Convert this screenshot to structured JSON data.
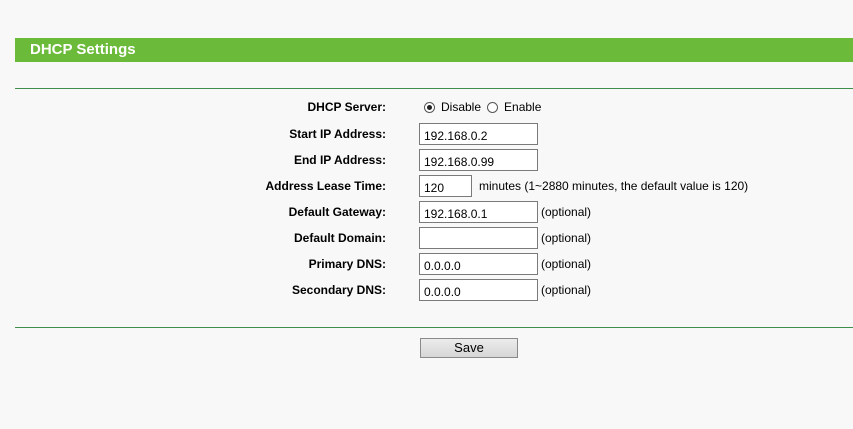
{
  "header": {
    "title": "DHCP Settings"
  },
  "form": {
    "dhcp_server": {
      "label": "DHCP Server:",
      "options": [
        {
          "label": "Disable",
          "checked": true
        },
        {
          "label": "Enable",
          "checked": false
        }
      ]
    },
    "start_ip": {
      "label": "Start IP Address:",
      "value": "192.168.0.2"
    },
    "end_ip": {
      "label": "End IP Address:",
      "value": "192.168.0.99"
    },
    "lease_time": {
      "label": "Address Lease Time:",
      "value": "120",
      "hint": "minutes (1~2880 minutes, the default value is 120)"
    },
    "default_gateway": {
      "label": "Default Gateway:",
      "value": "192.168.0.1",
      "hint": "(optional)"
    },
    "default_domain": {
      "label": "Default Domain:",
      "value": "",
      "hint": "(optional)"
    },
    "primary_dns": {
      "label": "Primary DNS:",
      "value": "0.0.0.0",
      "hint": "(optional)"
    },
    "secondary_dns": {
      "label": "Secondary DNS:",
      "value": "0.0.0.0",
      "hint": "(optional)"
    }
  },
  "actions": {
    "save_label": "Save"
  },
  "colors": {
    "header_bg": "#6bba3a",
    "rule": "#3f8f4a"
  }
}
